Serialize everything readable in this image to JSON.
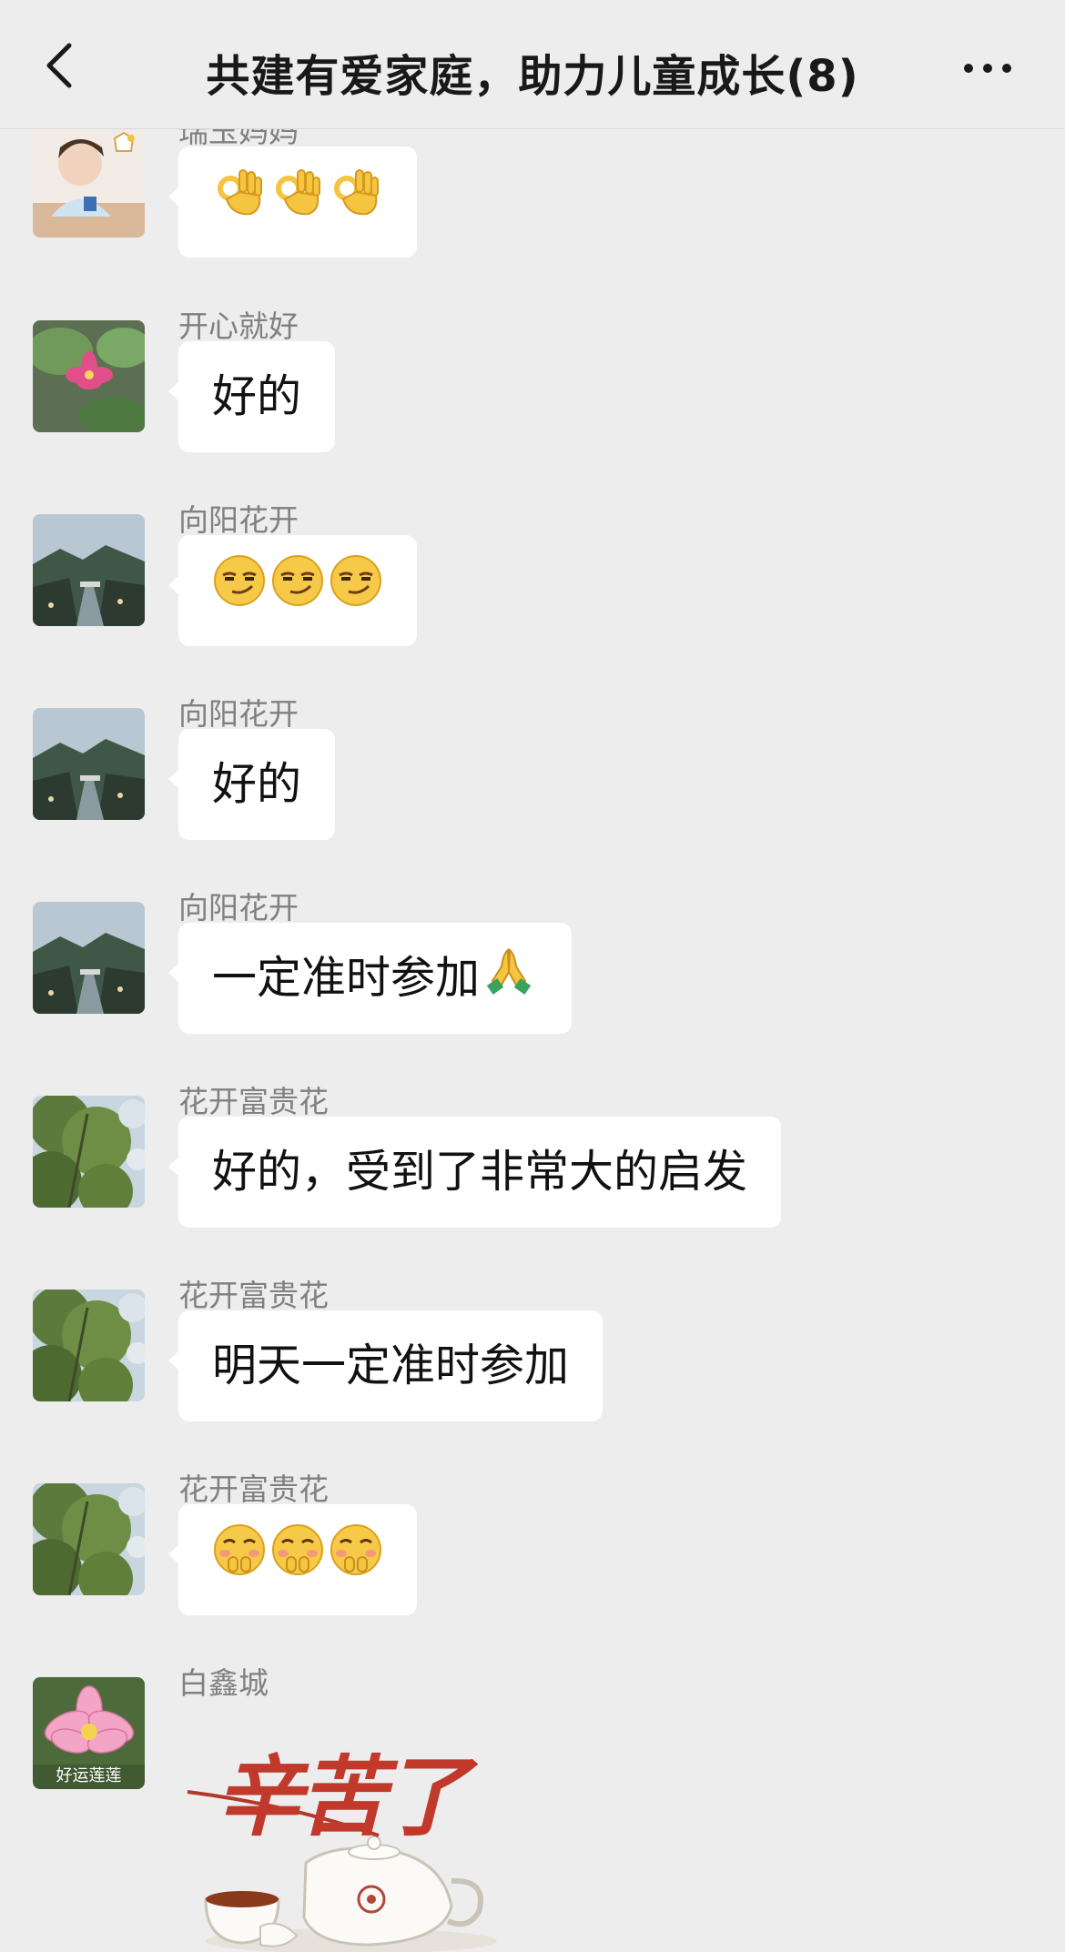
{
  "header": {
    "title": "共建有爱家庭，助力儿童成长(8)",
    "back_icon": "chevron-left-icon",
    "more_icon": "more-dots-icon"
  },
  "messages": [
    {
      "sender": "瑞玉妈妈",
      "type": "emoji",
      "emoji": "ok-hand-icon",
      "count": 3
    },
    {
      "sender": "开心就好",
      "type": "text",
      "text": "好的"
    },
    {
      "sender": "向阳花开",
      "type": "emoji",
      "emoji": "smirk-face-icon",
      "count": 3
    },
    {
      "sender": "向阳花开",
      "type": "text",
      "text": "好的"
    },
    {
      "sender": "向阳花开",
      "type": "text",
      "text": "一定准时参加",
      "trailing_emoji": "praying-hands-icon"
    },
    {
      "sender": "花开富贵花",
      "type": "text",
      "text": "好的，受到了非常大的启发"
    },
    {
      "sender": "花开富贵花",
      "type": "text",
      "text": "明天一定准时参加"
    },
    {
      "sender": "花开富贵花",
      "type": "emoji",
      "emoji": "shy-giggle-face-icon",
      "count": 3
    },
    {
      "sender": "白鑫城",
      "type": "sticker",
      "sticker_text": "辛苦了",
      "avatar_caption": "好运莲莲"
    }
  ],
  "colors": {
    "background": "#ededed",
    "bubble": "#ffffff",
    "sender_name": "#808080",
    "sticker_text": "#c0392b"
  }
}
